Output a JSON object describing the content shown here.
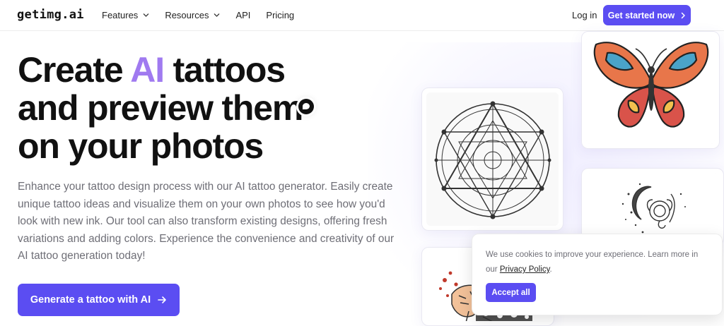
{
  "nav": {
    "logo": "getimg.ai",
    "menu": [
      {
        "label": "Features",
        "has_dropdown": true
      },
      {
        "label": "Resources",
        "has_dropdown": true
      },
      {
        "label": "API",
        "has_dropdown": false
      },
      {
        "label": "Pricing",
        "has_dropdown": false
      }
    ],
    "login": "Log in",
    "cta": "Get started now",
    "cta_icon": "chevron-right-icon"
  },
  "hero": {
    "headline_1a": "Create ",
    "headline_1b": "AI",
    "headline_1c": " tattoos",
    "headline_2": "and preview them",
    "headline_3": "on your photos",
    "description": "Enhance your tattoo design process with our AI tattoo generator. Easily create unique tattoo ideas and visualize them on your own photos to see how you'd look with new ink. Our tool can also transform existing designs, offering fresh variations and adding colors. Experience the convenience and creativity of our AI tattoo generation today!",
    "cta": "Generate a tattoo with AI",
    "cta_icon": "arrow-right-icon"
  },
  "gallery": [
    {
      "name": "geometric-tattoo-image"
    },
    {
      "name": "butterfly-tattoo-image"
    },
    {
      "name": "moon-flower-tattoo-image"
    },
    {
      "name": "tiger-tattoo-image"
    }
  ],
  "cookie": {
    "text_before": "We use cookies to improve your experience. Learn more in our ",
    "link": "Privacy Policy",
    "text_after": ".",
    "accept": "Accept all"
  },
  "colors": {
    "accent": "#5b4df2",
    "ai_highlight": "#a07af0",
    "body_text": "#6e6e76"
  }
}
